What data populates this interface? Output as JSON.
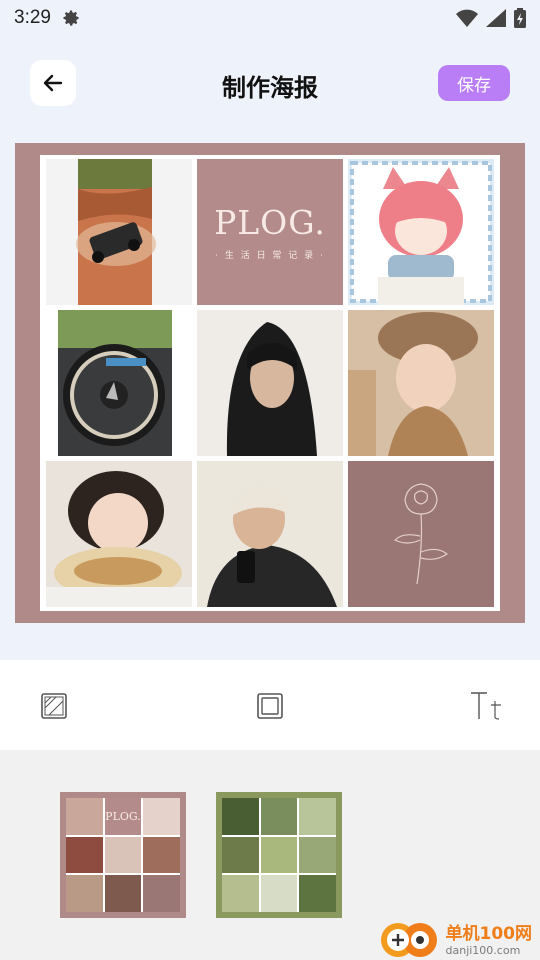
{
  "status": {
    "time": "3:29"
  },
  "header": {
    "title": "制作海报",
    "save_label": "保存"
  },
  "poster": {
    "frame_color": "#b08a89",
    "cells": [
      {
        "name": "photo-jeep-desert",
        "colors": [
          "#c26a3f",
          "#8c4a2a",
          "#2b2b2b"
        ]
      },
      {
        "name": "plog-title-card",
        "title": "PLOG.",
        "subtitle": "· 生 活 日 常 记 录 ·"
      },
      {
        "name": "anime-girl-illustration",
        "colors": [
          "#e9727b",
          "#a9c6dd",
          "#fff"
        ]
      },
      {
        "name": "photo-car-steering-wheel",
        "colors": [
          "#3a3a3a",
          "#6f8f4b",
          "#d9d0c2"
        ]
      },
      {
        "name": "photo-man-black-hoodie",
        "colors": [
          "#1c1c1c",
          "#efece8",
          "#d6b59c"
        ]
      },
      {
        "name": "photo-woman-fur-hat",
        "colors": [
          "#a1724c",
          "#e8d6c1",
          "#cfa184"
        ]
      },
      {
        "name": "photo-girl-bread-pillow",
        "colors": [
          "#2a211d",
          "#e8d9b8",
          "#f0d2c0"
        ]
      },
      {
        "name": "photo-man-white-beanie",
        "colors": [
          "#2b2b2b",
          "#ebe6dc",
          "#d7b297"
        ]
      },
      {
        "name": "rose-line-art-card",
        "colors": [
          "#9a7675",
          "#e5cfc8"
        ]
      }
    ]
  },
  "toolbar": {
    "items": [
      {
        "name": "background-tool-icon"
      },
      {
        "name": "frame-tool-icon"
      },
      {
        "name": "text-tool-icon"
      }
    ]
  },
  "templates": {
    "items": [
      {
        "name": "template-pink-plog",
        "frame": "#b08a89",
        "text": "PLOG."
      },
      {
        "name": "template-green-nature",
        "frame": "#8a9a5e"
      }
    ]
  },
  "watermark": {
    "site_cn": "单机100网",
    "site_url": "danji100.com"
  }
}
